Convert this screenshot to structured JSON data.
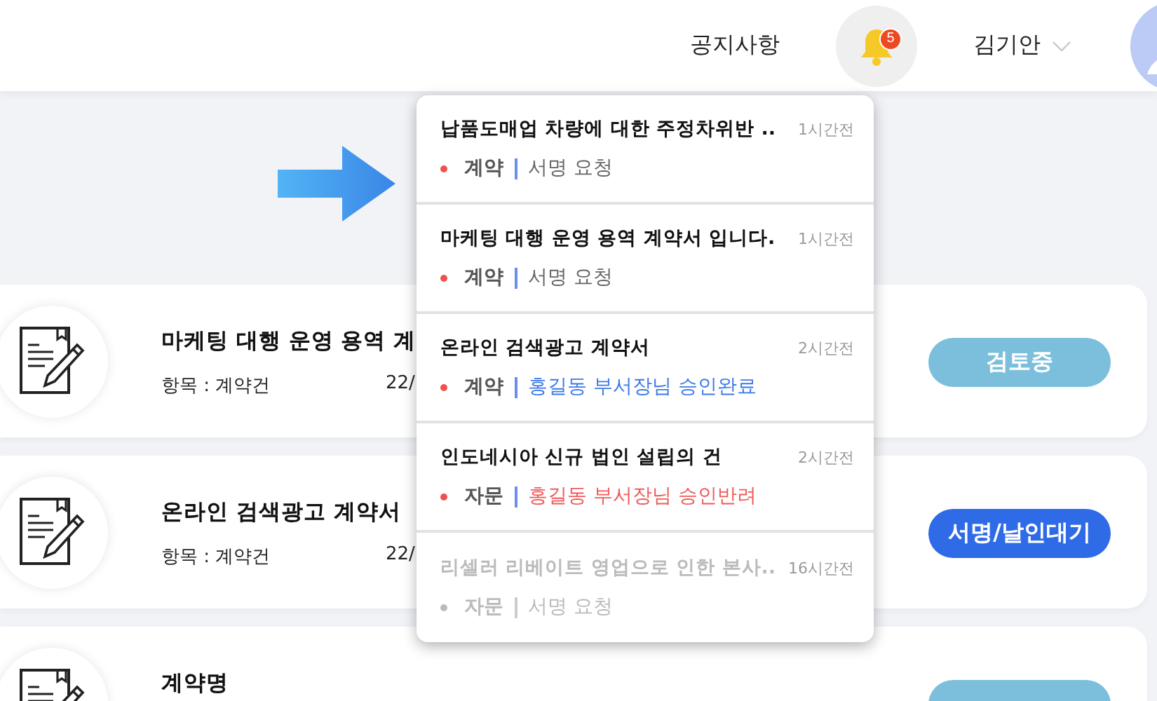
{
  "header": {
    "notice_link": "공지사항",
    "notification_count": "5",
    "user_name": "김기안"
  },
  "contracts": [
    {
      "title": "마케팅 대행 운영 용역 계",
      "category": "항목 : 계약건",
      "date": "22/",
      "status": "검토중",
      "kind": "review"
    },
    {
      "title": "온라인 검색광고 계약서",
      "category": "항목 : 계약건",
      "date": "22/",
      "status": "서명/날인대기",
      "kind": "sign"
    },
    {
      "title": "계약명",
      "kind": "review"
    }
  ],
  "notifications": [
    {
      "title": "납품도매업 차량에 대한 주정차위반 ..",
      "time": "1시간전",
      "type": "계약",
      "message": "서명 요청",
      "kind": "default",
      "read": false
    },
    {
      "title": "마케팅 대행 운영 용역 계약서 입니다.",
      "time": "1시간전",
      "type": "계약",
      "message": "서명 요청",
      "kind": "default",
      "read": false
    },
    {
      "title": "온라인 검색광고 계약서",
      "time": "2시간전",
      "type": "계약",
      "message": "홍길동 부서장님 승인완료",
      "kind": "approved",
      "read": false
    },
    {
      "title": "인도네시아 신규 법인 설립의 건",
      "time": "2시간전",
      "type": "자문",
      "message": "홍길동 부서장님 승인반려",
      "kind": "rejected",
      "read": false
    },
    {
      "title": "리셀러 리베이트 영업으로 인한 본사..",
      "time": "16시간전",
      "type": "자문",
      "message": "서명 요청",
      "kind": "default",
      "read": true
    }
  ]
}
